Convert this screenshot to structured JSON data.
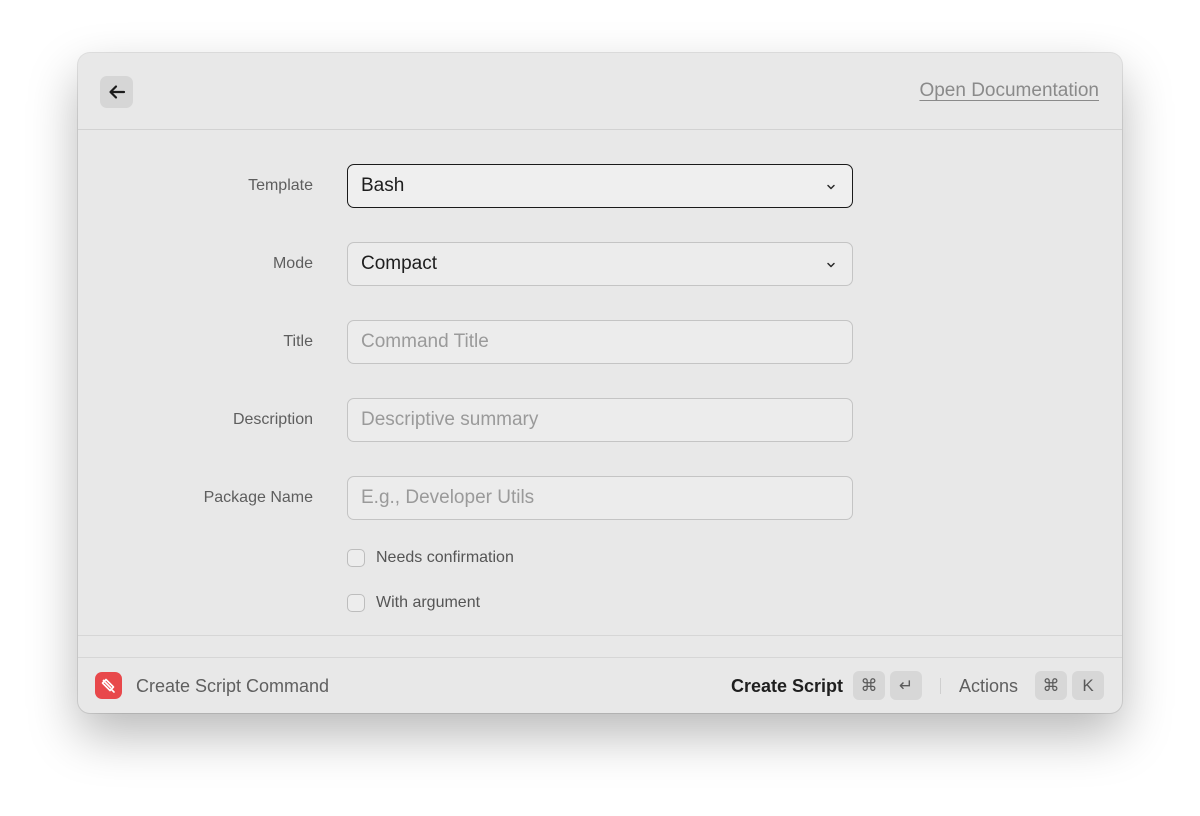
{
  "header": {
    "back_icon": "arrow-left-icon",
    "doc_link": "Open Documentation"
  },
  "form": {
    "template": {
      "label": "Template",
      "value": "Bash"
    },
    "mode": {
      "label": "Mode",
      "value": "Compact"
    },
    "title": {
      "label": "Title",
      "placeholder": "Command Title"
    },
    "description": {
      "label": "Description",
      "placeholder": "Descriptive summary"
    },
    "package": {
      "label": "Package Name",
      "placeholder": "E.g., Developer Utils"
    },
    "checkboxes": [
      {
        "label": "Needs confirmation",
        "checked": false
      },
      {
        "label": "With argument",
        "checked": false
      }
    ]
  },
  "footer": {
    "command_name": "Create Script Command",
    "primary_action": "Create Script",
    "primary_keys": [
      "⌘",
      "↵"
    ],
    "actions_label": "Actions",
    "actions_keys": [
      "⌘",
      "K"
    ]
  },
  "colors": {
    "window_bg": "#e8e8e8",
    "accent_red": "#e8484b",
    "focus_border": "#1a1a1a"
  }
}
